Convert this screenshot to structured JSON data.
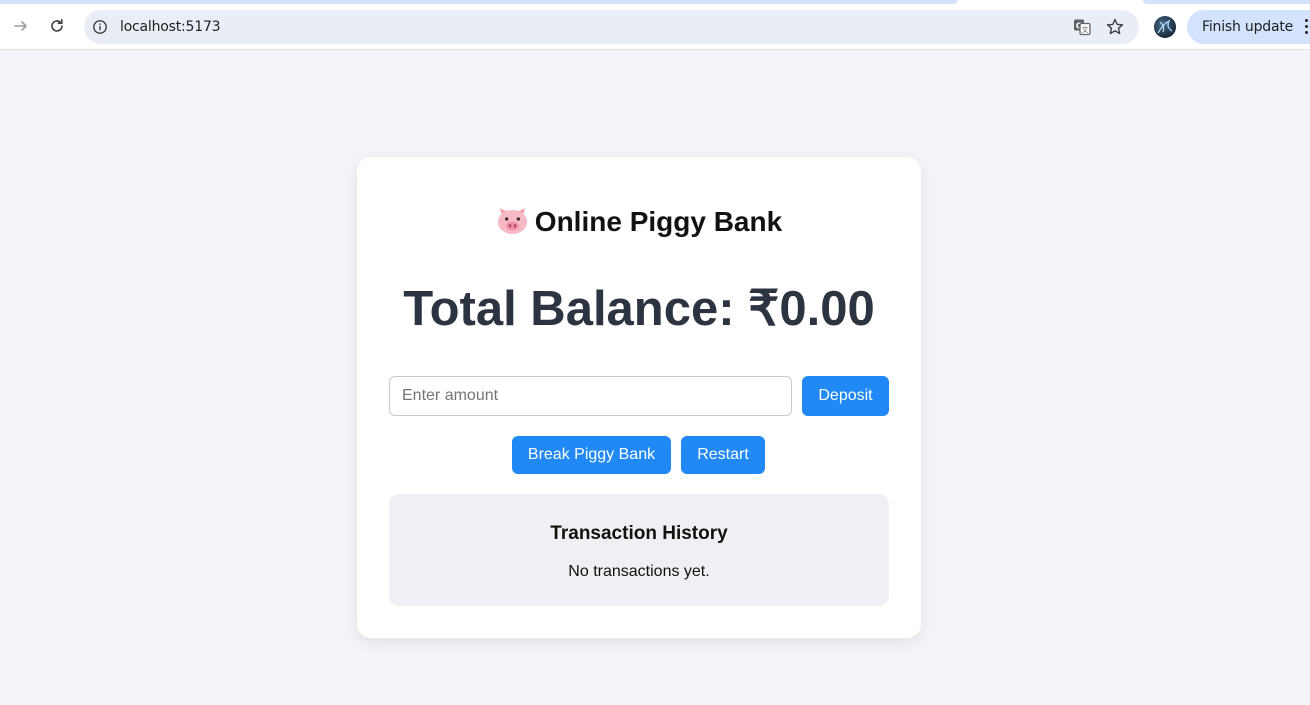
{
  "browser": {
    "url": "localhost:5173",
    "update_button_label": "Finish update",
    "icons": [
      "forward-icon",
      "reload-icon",
      "info-icon",
      "translate-icon",
      "star-icon",
      "kebab-menu-icon"
    ]
  },
  "app": {
    "title": "Online Piggy Bank",
    "title_icon": "pig-icon",
    "balance_text": "Total Balance: ₹0.00",
    "amount_input": {
      "placeholder": "Enter amount",
      "value": ""
    },
    "buttons": {
      "deposit": "Deposit",
      "break": "Break Piggy Bank",
      "restart": "Restart"
    },
    "history": {
      "title": "Transaction History",
      "empty_message": "No transactions yet."
    }
  },
  "colors": {
    "accent": "#2189f5",
    "page_background": "#f3f4f8",
    "balance_text": "#2d3441",
    "history_background": "#eff0f3"
  }
}
